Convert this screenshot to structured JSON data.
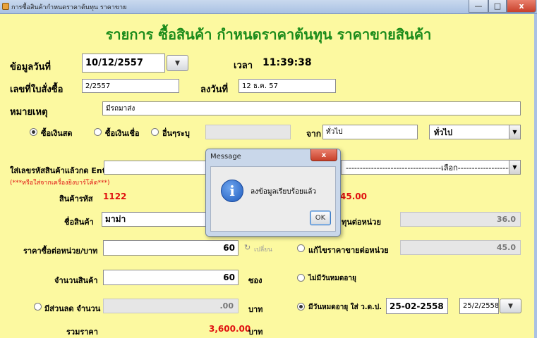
{
  "window": {
    "title": "การซื้อสินค้ากำหนดราคาต้นทุน ราคาขาย",
    "minimize_icon": "minimize-icon",
    "maximize_icon": "maximize-icon",
    "close_label": "x"
  },
  "heading": "รายการ ซื้อสินค้า กำหนดราคาต้นทุน ราคาขายสินค้า",
  "row1": {
    "date_label": "ข้อมูลวันที่",
    "date_value": "10/12/2557",
    "time_label": "เวลา",
    "time_value": "11:39:38"
  },
  "row2": {
    "order_label": "เลขที่ใบสั่งซื้อ",
    "order_value": "2/2557",
    "signed_label": "ลงวันที่",
    "signed_value": "12 ธ.ค. 57"
  },
  "row3": {
    "note_label": "หมายเหตุ",
    "note_value": "มีรถมาส่ง"
  },
  "payment": {
    "options": [
      "ซื้อเงินสด",
      "ซื้อเงินเชื่อ",
      "อื่นๆระบุ"
    ],
    "selected": "ซื้อเงินสด",
    "from_label": "จาก",
    "from_value": "ทั่วไป",
    "supplier_selected": "ทั่วไป"
  },
  "code_entry": {
    "label": "ใส่เลขรหัสสินค้าแล้วกด Enter",
    "hint": "(***หรือใส่จากเครื่องยิงบาร์โค้ด***)",
    "select_text": "----------------------------------เลือก------------------------------->"
  },
  "product": {
    "code_label": "สินค้ารหัส",
    "code_value": "1122",
    "hidden_price": "45.00",
    "name_label": "ชื่อสินค้า",
    "name_value": "มาม่า",
    "cost_unit_label": "ทุนต่อหน่วย",
    "cost_unit_value": "36.0",
    "buy_price_label": "ราคาซื้อต่อหน่วย/บาท",
    "buy_price_value": "60",
    "change_label": "เปลี่ยน",
    "edit_sell_label": "แก้ไขราคาขายต่อหน่วย",
    "sell_price_value": "45.0",
    "qty_label": "จำนวนสินค้า",
    "qty_value": "60",
    "qty_unit": "ซอง",
    "no_expiry_label": "ไม่มีวันหมดอายุ",
    "discount_label": "มีส่วนลด จำนวน",
    "discount_value": ".00",
    "baht_label": "บาท",
    "expiry_label": "มีวันหมดอายุ ใส่ ว.ด.ป.",
    "expiry_value": "25-02-2558",
    "expiry_date2": "25/2/2558",
    "total_label": "รวมราคา",
    "total_value": "3,600.00",
    "total_unit": "บาท"
  },
  "dialog": {
    "title": "Message",
    "close_label": "x",
    "message": "ลงข้อมูลเรียบร้อยแล้ว",
    "icon_glyph": "i",
    "ok_label": "OK"
  },
  "accent_colors": {
    "background": "#fcf9a0",
    "heading": "#1a8b1a",
    "red": "#e01010"
  }
}
